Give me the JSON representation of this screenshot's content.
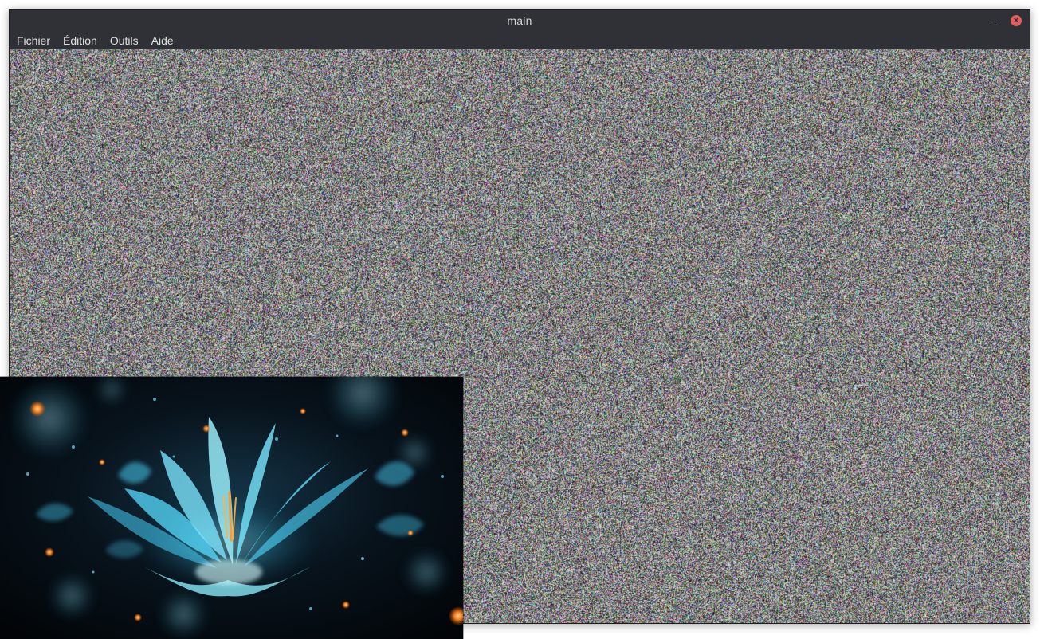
{
  "window": {
    "title": "main",
    "minimize_label": "‒",
    "close_label": "×"
  },
  "menubar": {
    "items": [
      {
        "label": "Fichier"
      },
      {
        "label": "Édition"
      },
      {
        "label": "Outils"
      },
      {
        "label": "Aide"
      }
    ]
  },
  "canvas": {
    "pattern": "random color noise"
  },
  "overlay": {
    "subject": "glowing blue fractal flower"
  },
  "colors": {
    "titlebar_bg": "#2f3136",
    "menubar_bg": "#2f3136",
    "close_button": "#e35d5d",
    "flower_cyan": "#4fd8ff",
    "spark_orange": "#ff8a1f"
  }
}
